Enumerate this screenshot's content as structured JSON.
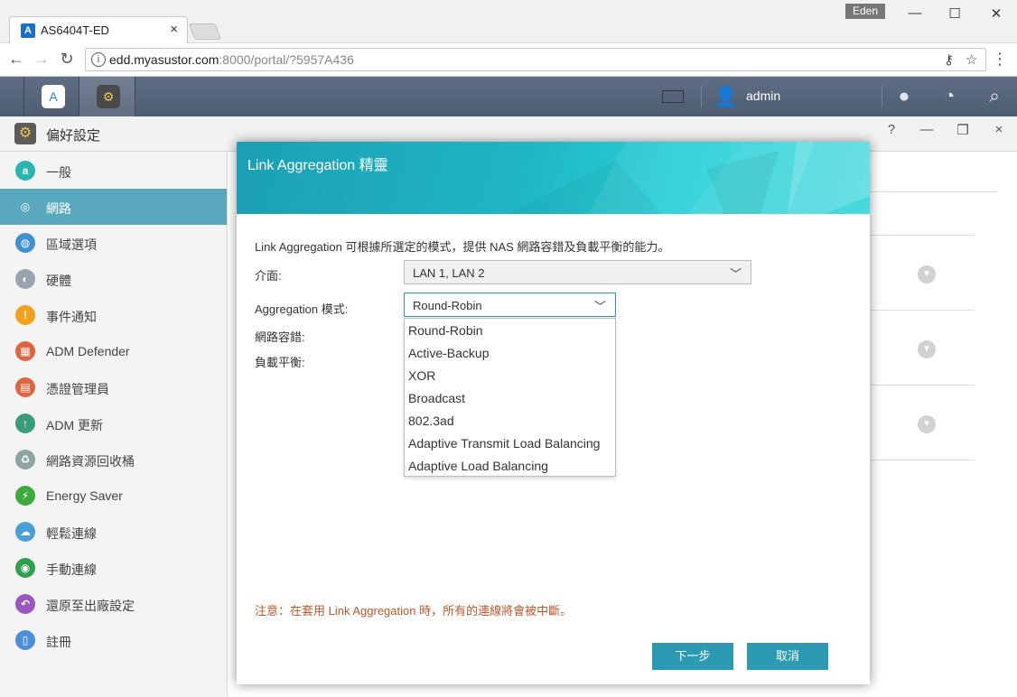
{
  "browser": {
    "tab_title": "AS6404T-ED",
    "tab_favicon": "A",
    "tab_close": "×",
    "profile": "Eden",
    "url_host": "edd.myasustor.com",
    "url_path": ":8000/portal/?5957A436",
    "icons": [
      "back-icon",
      "forward-icon",
      "reload-icon",
      "info-icon",
      "key-icon",
      "star-icon",
      "menu-icon",
      "minimize-icon",
      "maximize-icon",
      "close-icon"
    ]
  },
  "adm": {
    "username": "admin",
    "icons": [
      "app-central-icon",
      "preferences-icon",
      "keyboard-icon",
      "user-icon",
      "notification-icon",
      "dashboard-icon",
      "search-icon"
    ]
  },
  "window": {
    "title": "偏好設定",
    "help": "?",
    "minimize": "—",
    "close": "×"
  },
  "sidebar": {
    "items": [
      {
        "label": "一般",
        "icon": "general-icon",
        "color": "#2bb5b0",
        "glyph": "a"
      },
      {
        "label": "網路",
        "icon": "network-icon",
        "color": "#5aa8be",
        "glyph": "◎"
      },
      {
        "label": "區域選項",
        "icon": "globe-icon",
        "color": "#3f8fd2",
        "glyph": "◍"
      },
      {
        "label": "硬體",
        "icon": "hardware-icon",
        "color": "#9aa3ad",
        "glyph": "◐"
      },
      {
        "label": "事件通知",
        "icon": "alert-icon",
        "color": "#f2a01f",
        "glyph": "!"
      },
      {
        "label": "ADM Defender",
        "icon": "firewall-icon",
        "color": "#e0653e",
        "glyph": "▦"
      },
      {
        "label": "憑證管理員",
        "icon": "certificate-icon",
        "color": "#e0653e",
        "glyph": "▤"
      },
      {
        "label": "ADM 更新",
        "icon": "update-icon",
        "color": "#3b9c7a",
        "glyph": "↑"
      },
      {
        "label": "網路資源回收桶",
        "icon": "recycle-bin-icon",
        "color": "#8fa3a3",
        "glyph": "♻"
      },
      {
        "label": "Energy Saver",
        "icon": "energy-icon",
        "color": "#3caa3c",
        "glyph": "⚡"
      },
      {
        "label": "輕鬆連線",
        "icon": "cloud-connect-icon",
        "color": "#4a9fd8",
        "glyph": "☁"
      },
      {
        "label": "手動連線",
        "icon": "manual-connect-icon",
        "color": "#2f9e4e",
        "glyph": "◉"
      },
      {
        "label": "還原至出廠設定",
        "icon": "restore-icon",
        "color": "#9b57c0",
        "glyph": "↶"
      },
      {
        "label": "註冊",
        "icon": "register-icon",
        "color": "#4a8fd8",
        "glyph": "▯"
      }
    ],
    "active_index": 1
  },
  "wizard": {
    "title": "Link Aggregation 精靈",
    "description": "Link Aggregation 可根據所選定的模式，提供 NAS 網路容錯及負載平衡的能力。",
    "interface_label": "介面:",
    "interface_value": "LAN 1, LAN 2",
    "mode_label": "Aggregation 模式:",
    "mode_value": "Round-Robin",
    "fault_label": "網路容錯:",
    "balance_label": "負載平衡:",
    "mode_options": [
      "Round-Robin",
      "Active-Backup",
      "XOR",
      "Broadcast",
      "802.3ad",
      "Adaptive Transmit Load Balancing",
      "Adaptive Load Balancing"
    ],
    "note": "注意：在套用 Link Aggregation 時，所有的連線將會被中斷。",
    "next_button": "下一步",
    "cancel_button": "取消"
  },
  "colors": {
    "accent": "#2a9bb3",
    "sidebar_active": "#5aa8be",
    "note": "#c0572b",
    "adm_bar": "#56637a"
  }
}
